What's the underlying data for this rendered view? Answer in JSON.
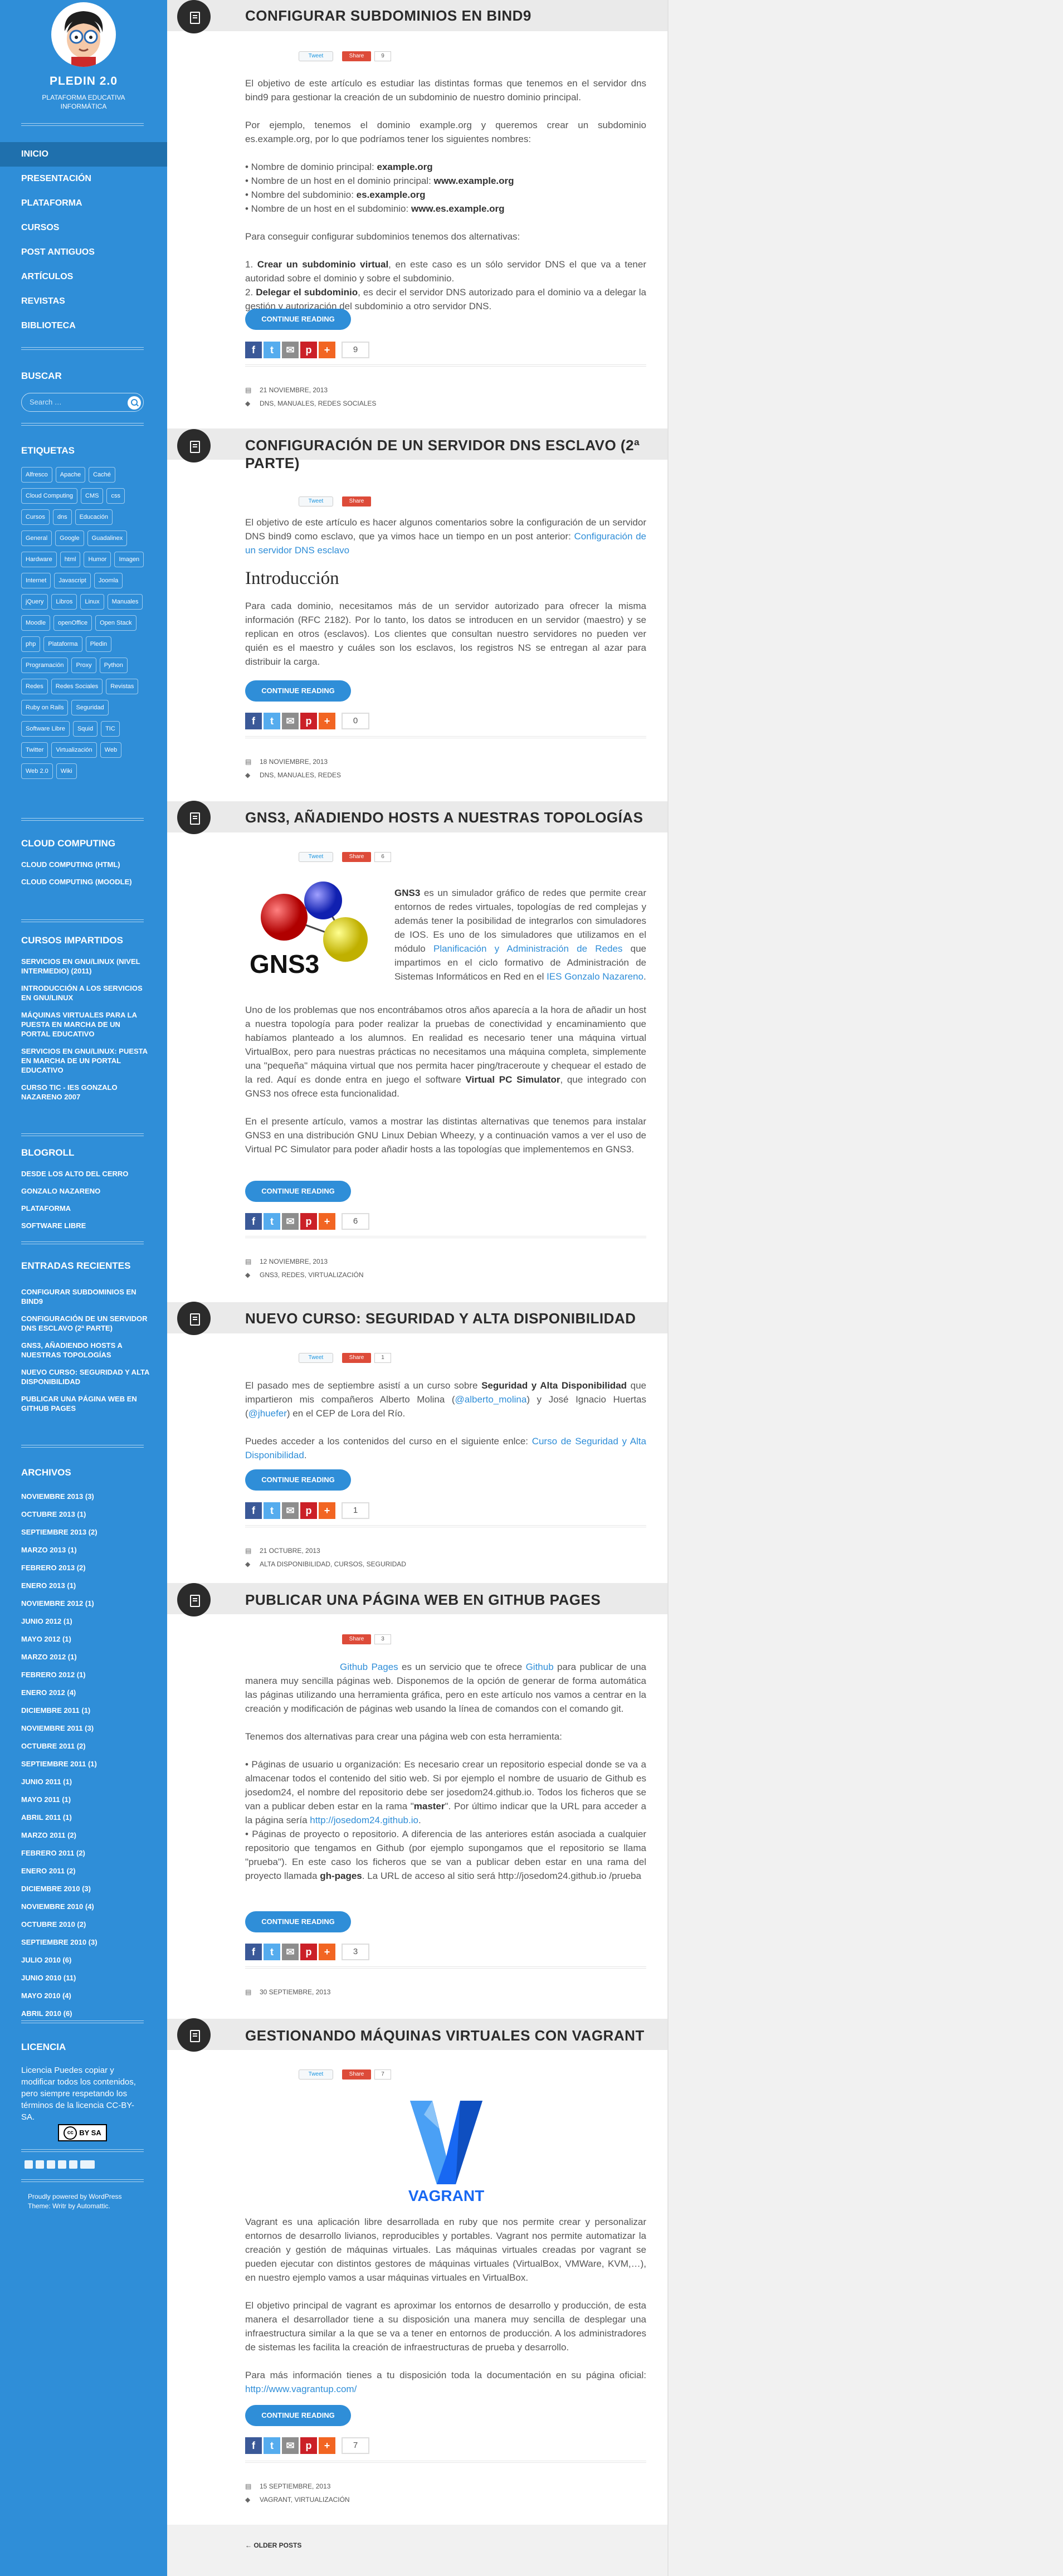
{
  "site": {
    "title": "PLEDIN 2.0",
    "description": "PLATAFORMA EDUCATIVA INFORMÁTICA"
  },
  "nav": [
    "INICIO",
    "PRESENTACIÓN",
    "PLATAFORMA",
    "CURSOS",
    "POST ANTIGUOS",
    "ARTÍCULOS",
    "REVISTAS",
    "BIBLIOTECA"
  ],
  "search": {
    "heading": "BUSCAR",
    "placeholder": "Search …"
  },
  "tags_heading": "ETIQUETAS",
  "tags": [
    "Alfresco",
    "Apache",
    "Caché",
    "Cloud Computing",
    "CMS",
    "css",
    "Cursos",
    "dns",
    "Educación",
    "General",
    "Google",
    "Guadalinex",
    "Hardware",
    "html",
    "Humor",
    "Imagen",
    "Internet",
    "Javascript",
    "Joomla",
    "jQuery",
    "Libros",
    "Linux",
    "Manuales",
    "Moodle",
    "openOffice",
    "Open Stack",
    "php",
    "Plataforma",
    "Pledin",
    "Programación",
    "Proxy",
    "Python",
    "Redes",
    "Redes Sociales",
    "Revistas",
    "Ruby on Rails",
    "Seguridad",
    "Software Libre",
    "Squid",
    "TIC",
    "Twitter",
    "Virtualización",
    "Web",
    "Web 2.0",
    "Wiki"
  ],
  "cloud": {
    "heading": "CLOUD COMPUTING",
    "items": [
      "CLOUD COMPUTING (HTML)",
      "CLOUD COMPUTING (MOODLE)"
    ]
  },
  "cursos": {
    "heading": "CURSOS IMPARTIDOS",
    "items": [
      "SERVICIOS EN GNU/LINUX (NIVEL INTERMEDIO) (2011)",
      "INTRODUCCIÓN A LOS SERVICIOS EN GNU/LINUX",
      "MÁQUINAS VIRTUALES PARA LA PUESTA EN MARCHA DE UN PORTAL EDUCATIVO",
      "SERVICIOS EN GNU/LINUX: PUESTA EN MARCHA DE UN PORTAL EDUCATIVO",
      "CURSO TIC - IES GONZALO NAZARENO 2007"
    ]
  },
  "blogroll": {
    "heading": "BLOGROLL",
    "items": [
      "DESDE LOS ALTO DEL CERRO",
      "GONZALO NAZARENO",
      "PLATAFORMA",
      "SOFTWARE LIBRE"
    ]
  },
  "recientes": {
    "heading": "ENTRADAS RECIENTES",
    "items": [
      "CONFIGURAR SUBDOMINIOS EN BIND9",
      "CONFIGURACIÓN DE UN SERVIDOR DNS ESCLAVO (2ª PARTE)",
      "GNS3, AÑADIENDO HOSTS A NUESTRAS TOPOLOGÍAS",
      "NUEVO CURSO: SEGURIDAD Y ALTA DISPONIBILIDAD",
      "PUBLICAR UNA PÁGINA WEB EN GITHUB PAGES"
    ]
  },
  "archivos": {
    "heading": "ARCHIVOS",
    "items": [
      "NOVIEMBRE 2013 (3)",
      "OCTUBRE 2013 (1)",
      "SEPTIEMBRE 2013 (2)",
      "MARZO 2013 (1)",
      "FEBRERO 2013 (2)",
      "ENERO 2013 (1)",
      "NOVIEMBRE 2012 (1)",
      "JUNIO 2012 (1)",
      "MAYO 2012 (1)",
      "MARZO 2012 (1)",
      "FEBRERO 2012 (1)",
      "ENERO 2012 (4)",
      "DICIEMBRE 2011 (1)",
      "NOVIEMBRE 2011 (3)",
      "OCTUBRE 2011 (2)",
      "SEPTIEMBRE 2011 (1)",
      "JUNIO 2011 (1)",
      "MAYO 2011 (1)",
      "ABRIL 2011 (1)",
      "MARZO 2011 (2)",
      "FEBRERO 2011 (2)",
      "ENERO 2011 (2)",
      "DICIEMBRE 2010 (3)",
      "NOVIEMBRE 2010 (4)",
      "OCTUBRE 2010 (2)",
      "SEPTIEMBRE 2010 (3)",
      "JULIO 2010 (6)",
      "JUNIO 2010 (11)",
      "MAYO 2010 (4)",
      "ABRIL 2010 (6)"
    ]
  },
  "license": {
    "heading": "LICENCIA",
    "text": "Licencia Puedes copiar y modificar todos los contenidos, pero siempre respetando los términos de la licencia CC-BY-SA.",
    "badge": "BY SA"
  },
  "powered": "Proudly powered by WordPress Theme: Writr by Automattic.",
  "share": {
    "tweet": "Tweet",
    "gplus": "Share"
  },
  "continue": "CONTINUE READING",
  "older": "OLDER POSTS",
  "posts": [
    {
      "title": "CONFIGURAR SUBDOMINIOS EN BIND9",
      "gcount": "9",
      "count": "9",
      "date": "21 NOVIEMBRE, 2013",
      "tags": "DNS, MANUALES, REDES SOCIALES",
      "p1": "El objetivo de este artículo es estudiar las distintas formas que tenemos en el servidor dns bind9 para gestionar la creación de un subdominio de nuestro dominio principal.",
      "p2": "Por ejemplo, tenemos el dominio example.org y queremos crear un subdominio es.example.org, por lo que podríamos tener los siguientes nombres:",
      "l1a": "• Nombre de dominio principal: ",
      "l1b": "example.org",
      "l2a": "• Nombre de un host en el dominio principal: ",
      "l2b": "www.example.org",
      "l3a": "• Nombre del subdominio: ",
      "l3b": "es.example.org",
      "l4a": "• Nombre de un host en el subdominio: ",
      "l4b": "www.es.example.org",
      "p3": "Para conseguir configurar subdominios tenemos dos alternativas:",
      "o1a": "1. ",
      "o1b": "Crear un subdominio virtual",
      "o1c": ", en este caso es un sólo servidor DNS el que va a tener autoridad sobre el dominio y sobre el subdominio.",
      "o2a": "2. ",
      "o2b": "Delegar el subdominio",
      "o2c": ", es decir el servidor DNS autorizado para el dominio va a delegar la gestión y autorización del subdominio a otro servidor DNS."
    },
    {
      "title": "CONFIGURACIÓN DE UN SERVIDOR DNS ESCLAVO (2ª PARTE)",
      "count": "0",
      "date": "18 NOVIEMBRE, 2013",
      "tags": "DNS, MANUALES, REDES",
      "p1": "El objetivo de este artículo es hacer algunos comentarios sobre la configuración de un servidor DNS bind9 como esclavo, que ya vimos hace un tiempo en un post anterior: ",
      "p1link": "Configuración de un servidor DNS esclavo",
      "heading": "Introducción",
      "p2": "Para cada dominio, necesitamos más de un servidor autorizado para ofrecer la misma información (RFC 2182). Por lo tanto, los datos se introducen en un servidor (maestro) y se replican en otros (esclavos). Los clientes que consultan nuestro servidores no pueden ver quién es el maestro y cuáles son los esclavos, los registros NS se entregan al azar para distribuir la carga."
    },
    {
      "title": "GNS3, AÑADIENDO HOSTS A NUESTRAS TOPOLOGÍAS",
      "gcount": "6",
      "count": "6",
      "date": "12 NOVIEMBRE, 2013",
      "tags": "GNS3, REDES, VIRTUALIZACIÓN",
      "logo": "GNS3",
      "p1a": "GNS3",
      "p1b": " es un simulador gráfico de redes que permite crear entornos de redes virtuales, topologías de red complejas y además tener la posibilidad de integrarlos con simuladores de IOS. Es uno de los simuladores que utilizamos en el módulo ",
      "p1link1": "Planificación y Administración de Redes",
      "p1c": " que impartimos en el ciclo formativo de Administración de Sistemas Informáticos en Red en el ",
      "p1link2": "IES Gonzalo Nazareno",
      "p1d": ".",
      "p2": "Uno de los problemas que nos encontrábamos otros años aparecía a la hora de añadir un host a nuestra topología para poder realizar la pruebas de conectividad y encaminamiento que habíamos planteado a los alumnos. En realidad es necesario tener una máquina virtual VirtualBox, pero para nuestras prácticas no necesitamos una máquina completa, simplemente una \"pequeña\" máquina virtual que nos permita hacer ping/traceroute y chequear el estado de la red. Aquí es donde entra en juego el software ",
      "p2b": "Virtual PC Simulator",
      "p2c": ", que integrado con GNS3 nos ofrece esta funcionalidad.",
      "p3": "En el presente artículo, vamos a mostrar las distintas alternativas que tenemos para instalar GNS3 en una distribución GNU Linux Debian Wheezy, y a continuación vamos a ver el uso de Virtual PC Simulator para poder añadir hosts a las topologías que implementemos en GNS3."
    },
    {
      "title": "NUEVO CURSO: SEGURIDAD Y ALTA DISPONIBILIDAD",
      "gcount": "1",
      "count": "1",
      "date": "21 OCTUBRE, 2013",
      "tags": "ALTA DISPONIBILIDAD, CURSOS, SEGURIDAD",
      "p1a": "El pasado mes de septiembre asistí a un curso sobre ",
      "p1b": "Seguridad y Alta Disponibilidad",
      "p1c": " que impartieron mis compañeros Alberto Molina (",
      "p1link1": "@alberto_molina",
      "p1d": ") y José Ignacio Huertas (",
      "p1link2": "@jhuefer",
      "p1e": ") en el CEP de Lora del Río.",
      "p2": "Puedes acceder a los contenidos del curso en el siguiente enlce: ",
      "p2link": "Curso de Seguridad y Alta Disponibilidad",
      "p2b": "."
    },
    {
      "title": "PUBLICAR UNA PÁGINA WEB EN GITHUB PAGES",
      "gcount": "3",
      "count": "3",
      "date": "30 SEPTIEMBRE, 2013",
      "p1link1": "Github Pages",
      "p1a": " es un servicio que te ofrece ",
      "p1link2": "Github",
      "p1b": " para publicar de una manera muy sencilla páginas web. Disponemos de la opción de generar de forma automática las páginas utilizando una herramienta gráfica, pero en este artículo nos vamos a centrar en la creación y modificación de páginas web usando la línea de comandos con el comando git.",
      "p2": "Tenemos dos alternativas para crear una página web con esta herramienta:",
      "b1": "• Páginas de usuario u organización: Es necesario crear un repositorio especial donde se va a almacenar todos el contenido del sitio web. Si por ejemplo el nombre de usuario de Github es josedom24, el nombre del repositorio debe ser josedom24.github.io. Todos los ficheros que se van a publicar deben estar en la rama \"",
      "b1b": "master",
      "b1c": "\". Por último indicar que la URL para acceder a la página sería ",
      "b1link": "http://josedom24.github.io",
      "b1d": ".",
      "b2": "• Páginas de proyecto o repositorio. A diferencia de las anteriores están asociada a cualquier repositorio que tengamos en Github (por ejemplo supongamos que el repositorio se llama \"prueba\"). En este caso los ficheros que se van a publicar deben estar en una rama del proyecto llamada ",
      "b2b": "gh-pages",
      "b2c": ". La URL de acceso al sitio será http://josedom24.github.io /prueba"
    },
    {
      "title": "GESTIONANDO MÁQUINAS VIRTUALES CON VAGRANT",
      "gcount": "7",
      "count": "7",
      "date": "15 SEPTIEMBRE, 2013",
      "tags": "VAGRANT, VIRTUALIZACIÓN",
      "logo": "VAGRANT",
      "p1": "Vagrant es una aplicación libre desarrollada en ruby que nos permite crear y personalizar entornos de desarrollo livianos, reproducibles y portables. Vagrant nos permite automatizar la creación y gestión de máquinas virtuales. Las máquinas virtuales creadas por vagrant se pueden ejecutar con distintos gestores de máquinas virtuales (VirtualBox, VMWare, KVM,…), en nuestro ejemplo vamos a usar máquinas virtuales en VirtualBox.",
      "p2": "El objetivo principal de vagrant es aproximar los entornos de desarrollo y producción, de esta manera el desarrollador tiene a su disposición una manera muy sencilla de desplegar una infraestructura similar a la que se va a tener en entornos de producción. A los administradores de sistemas les facilita la creación de infraestructuras de prueba y desarrollo.",
      "p3": "Para más información tienes a tu disposición toda la documentación en su página oficial: ",
      "p3link": "http://www.vagrantup.com/"
    }
  ],
  "colors": {
    "sidebar": "#2f8ed8",
    "active_nav": "#1f70ad",
    "facebook": "#3b5998",
    "twitter": "#55acee",
    "email": "#8d8d8d",
    "pinterest": "#cb2027",
    "plus": "#f26522",
    "gplus": "#dd4b39"
  }
}
